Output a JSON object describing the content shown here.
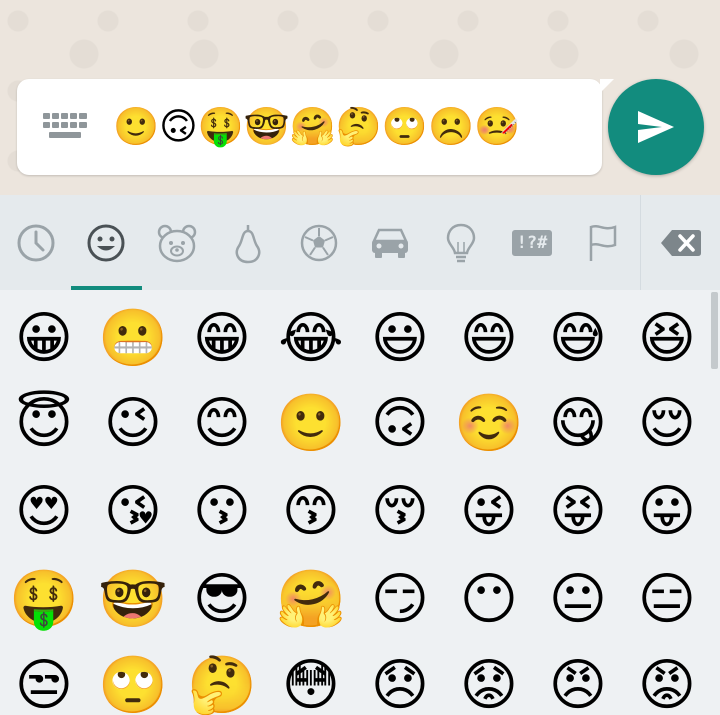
{
  "composer": {
    "message": "🙂🙃🤑🤓🤗🤔🙄☹️🤒"
  },
  "tabs": [
    {
      "name": "recent",
      "icon": "clock-icon"
    },
    {
      "name": "smileys",
      "icon": "smiley-icon",
      "selected": true
    },
    {
      "name": "animals",
      "icon": "bear-icon"
    },
    {
      "name": "food",
      "icon": "pear-icon"
    },
    {
      "name": "activity",
      "icon": "soccer-ball-icon"
    },
    {
      "name": "travel",
      "icon": "car-icon"
    },
    {
      "name": "objects",
      "icon": "lightbulb-icon"
    },
    {
      "name": "symbols",
      "icon": "symbols-icon",
      "label": "!?#"
    },
    {
      "name": "flags",
      "icon": "flag-icon"
    }
  ],
  "colors": {
    "accent": "#128c7e",
    "tab_bar": "#e5eaed",
    "grid_background": "#eef1f3",
    "icon_gray": "#9aa3a8"
  },
  "emoji_grid": [
    [
      "😀",
      "😬",
      "😁",
      "😂",
      "😃",
      "😄",
      "😅",
      "😆"
    ],
    [
      "😇",
      "😉",
      "😊",
      "🙂",
      "🙃",
      "☺️",
      "😋",
      "😌"
    ],
    [
      "😍",
      "😘",
      "😗",
      "😙",
      "😚",
      "😜",
      "😝",
      "😛"
    ],
    [
      "🤑",
      "🤓",
      "😎",
      "🤗",
      "😏",
      "😶",
      "😐",
      "😑"
    ],
    [
      "😒",
      "🙄",
      "🤔",
      "😳",
      "😞",
      "😟",
      "😠",
      "😡"
    ]
  ]
}
